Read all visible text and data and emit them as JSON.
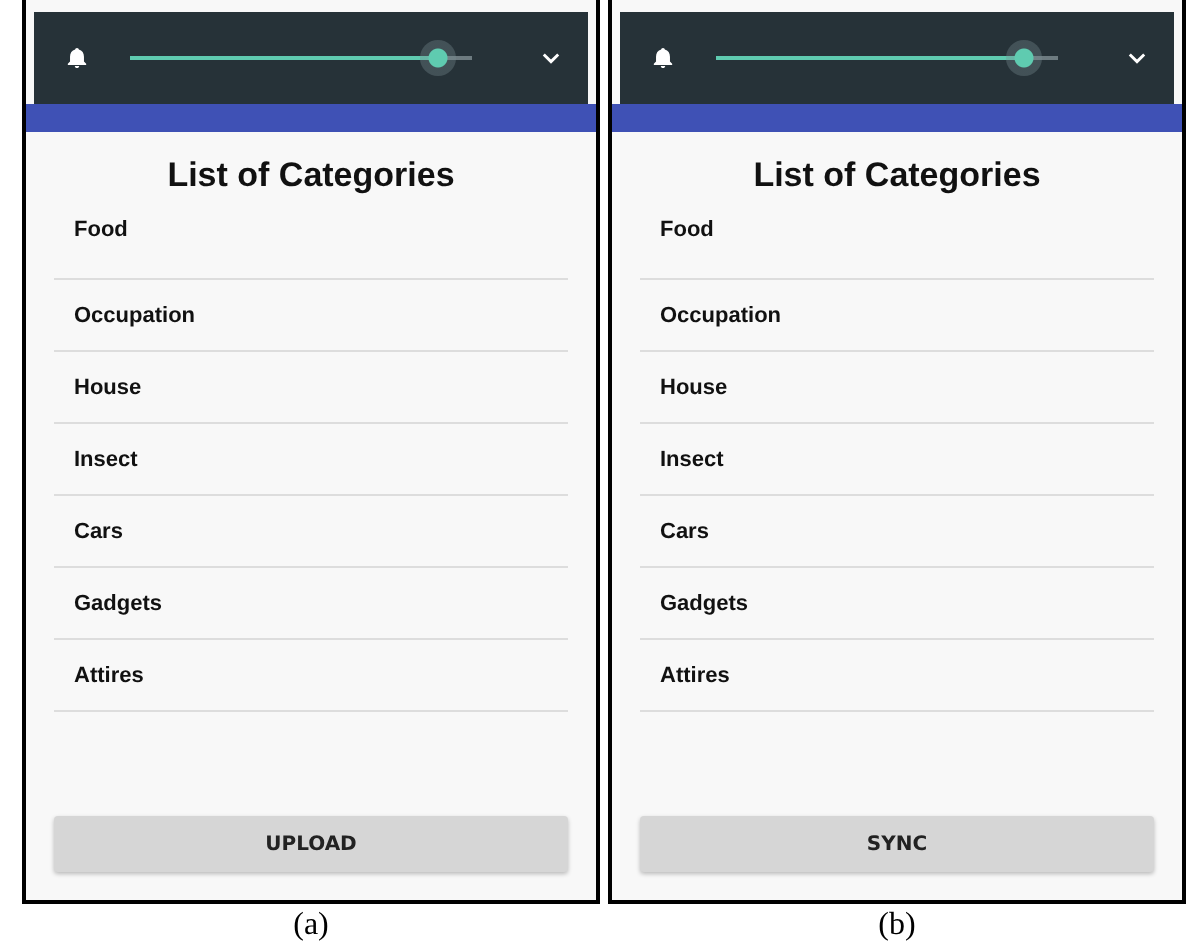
{
  "panels": [
    {
      "caption": "(a)",
      "slider": {
        "level": 0.9
      },
      "title": "List of Categories",
      "categories": [
        "Food",
        "Occupation",
        "House",
        "Insect",
        "Cars",
        "Gadgets",
        "Attires"
      ],
      "button": "UPLOAD"
    },
    {
      "caption": "(b)",
      "slider": {
        "level": 0.9
      },
      "title": "List of Categories",
      "categories": [
        "Food",
        "Occupation",
        "House",
        "Insect",
        "Cars",
        "Gadgets",
        "Attires"
      ],
      "button": "SYNC"
    }
  ]
}
